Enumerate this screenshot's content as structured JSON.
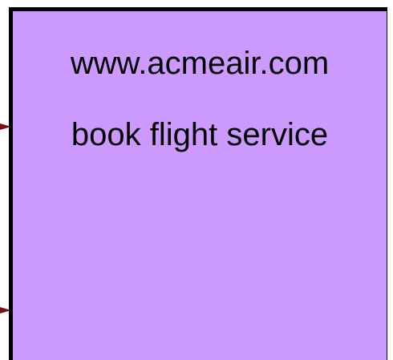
{
  "service": {
    "url": "www.acmeair.com",
    "name": "book flight service"
  },
  "colors": {
    "box_fill": "#cc99ff",
    "box_border": "#000000",
    "arrow": "#7a1010"
  }
}
